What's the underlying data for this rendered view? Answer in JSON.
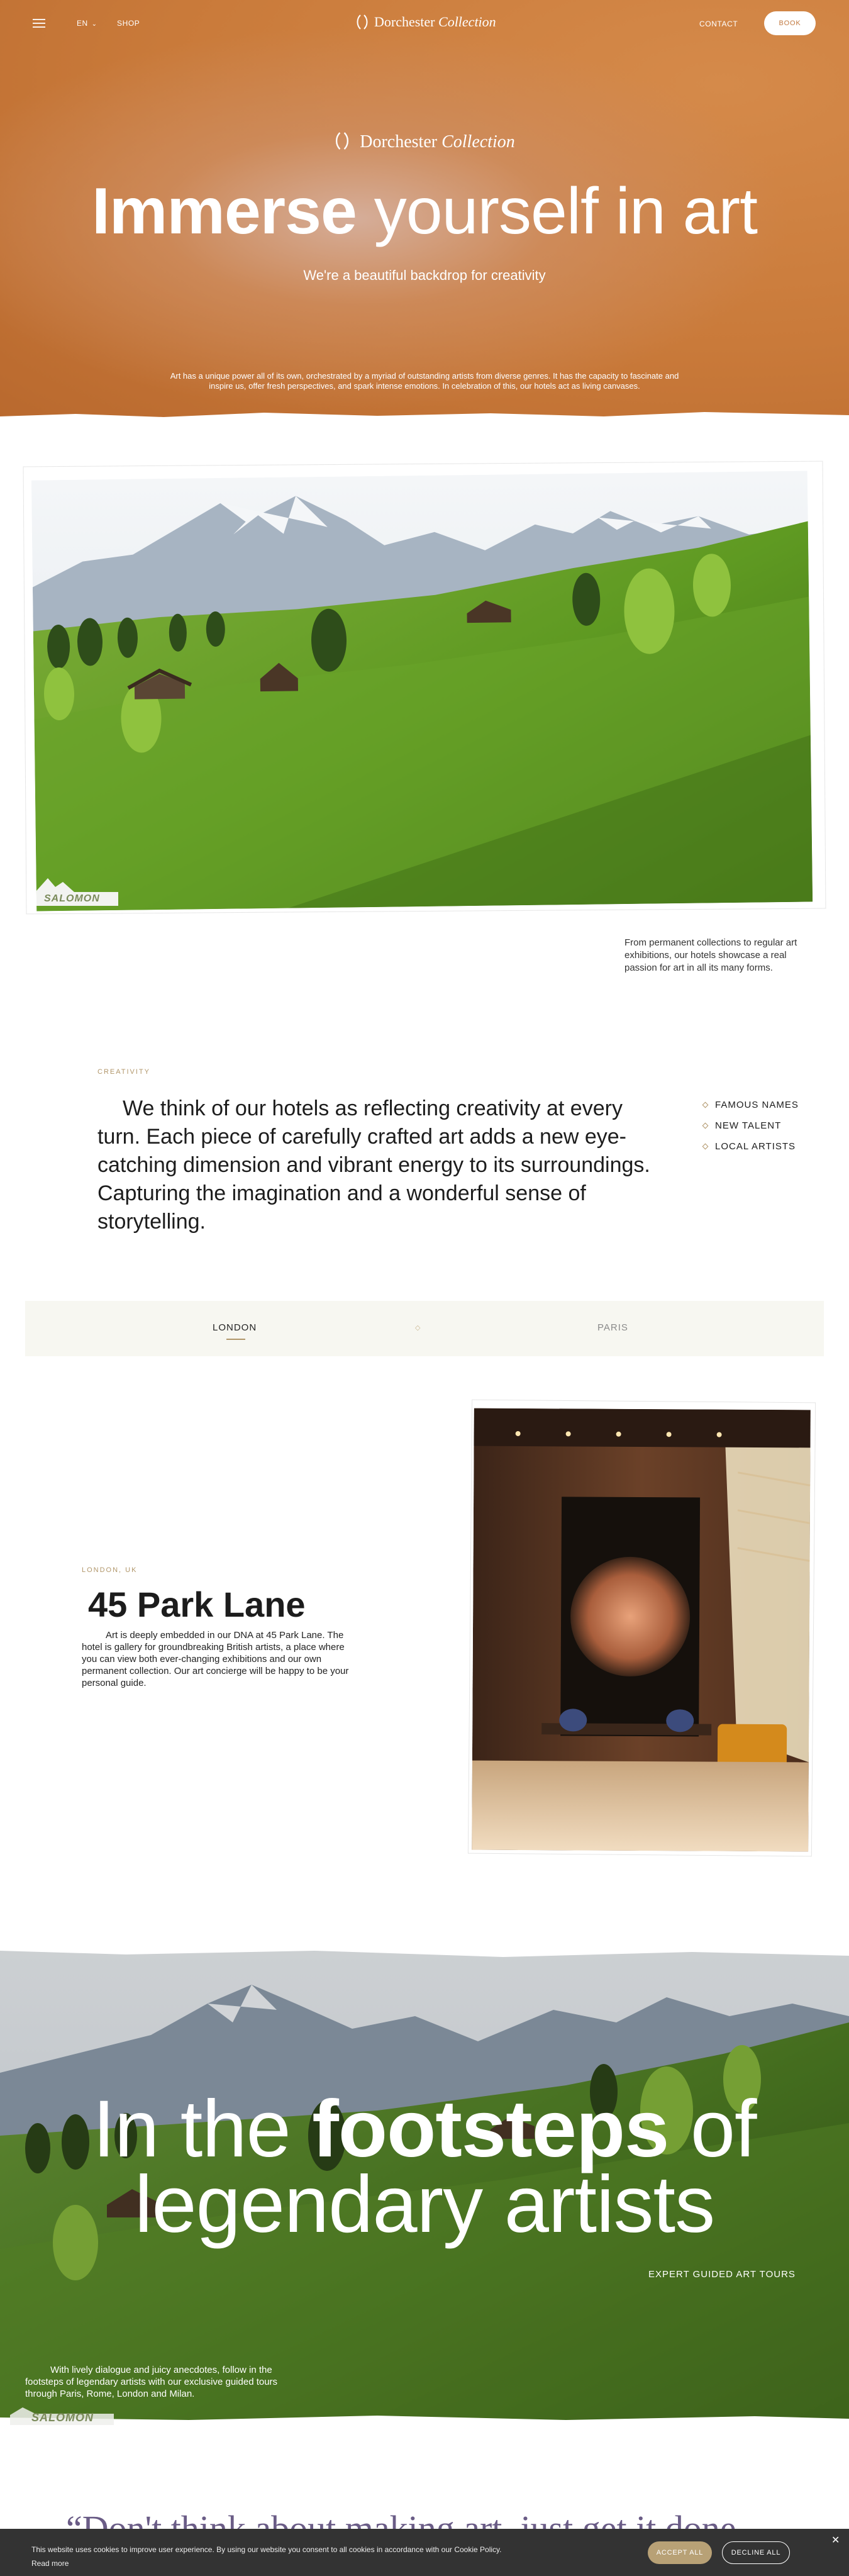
{
  "header": {
    "menu_icon": "hamburger-menu-icon",
    "language": "EN",
    "shop": "SHOP",
    "logo_primary": "Dorchester",
    "logo_italic": "Collection",
    "contact": "CONTACT",
    "book": "BOOK"
  },
  "hero": {
    "logo_primary": "Dorchester",
    "logo_italic": "Collection",
    "title_bold": "Immerse",
    "title_light": " yourself in art",
    "subtitle": "We're a beautiful backdrop for creativity",
    "description": "Art has a unique power all of its own, orchestrated by a myriad of outstanding artists from diverse genres. It has the capacity to fascinate and inspire us, offer fresh perspectives, and spark intense emotions. In celebration of this, our hotels act as living canvases."
  },
  "gallery": {
    "watermark": "SALOMON",
    "caption": "From permanent collections to regular art exhibitions, our hotels showcase a real passion for art in all its many forms."
  },
  "creativity": {
    "eyebrow": "CREATIVITY",
    "quote": "We think of our hotels as reflecting creativity at every turn. Each piece of carefully crafted art adds a new eye-catching dimension and vibrant energy to its surroundings. Capturing the imagination and a wonderful sense of storytelling.",
    "bullets": [
      "FAMOUS NAMES",
      "NEW TALENT",
      "LOCAL ARTISTS"
    ]
  },
  "tabs": {
    "items": [
      "LONDON",
      "PARIS"
    ],
    "active": "LONDON"
  },
  "park_lane": {
    "eyebrow": "LONDON, UK",
    "title": "45 Park Lane",
    "description": "Art is deeply embedded in our DNA at 45 Park Lane. The hotel is gallery for groundbreaking British artists, a place where you can view both ever-changing exhibitions and our own permanent collection. Our art concierge will be happy to be your personal guide."
  },
  "footsteps": {
    "title_1": "In the ",
    "title_bold": "footsteps",
    "title_2": " of",
    "title_line2": "legendary artists",
    "link": "EXPERT GUIDED ART TOURS",
    "description": "With lively dialogue and juicy anecdotes, follow in the footsteps of legendary artists with our exclusive guided tours through Paris, Rome, London and Milan.",
    "watermark": "SALOMON"
  },
  "big_quote": {
    "text": "“Don't think about making art, just get it done. Let everyone else decide if it's good"
  },
  "cookie": {
    "text": "This website uses cookies to improve user experience. By using our website you consent to all cookies in accordance with our Cookie Policy.",
    "read_more": "Read more",
    "accept": "ACCEPT ALL",
    "decline": "DECLINE ALL",
    "close_icon": "close-icon"
  },
  "colors": {
    "hero_orange": "#c97a3a",
    "accent_gold": "#b1966a",
    "tab_bg": "#f7f7f1",
    "cookie_bg": "#333333"
  }
}
